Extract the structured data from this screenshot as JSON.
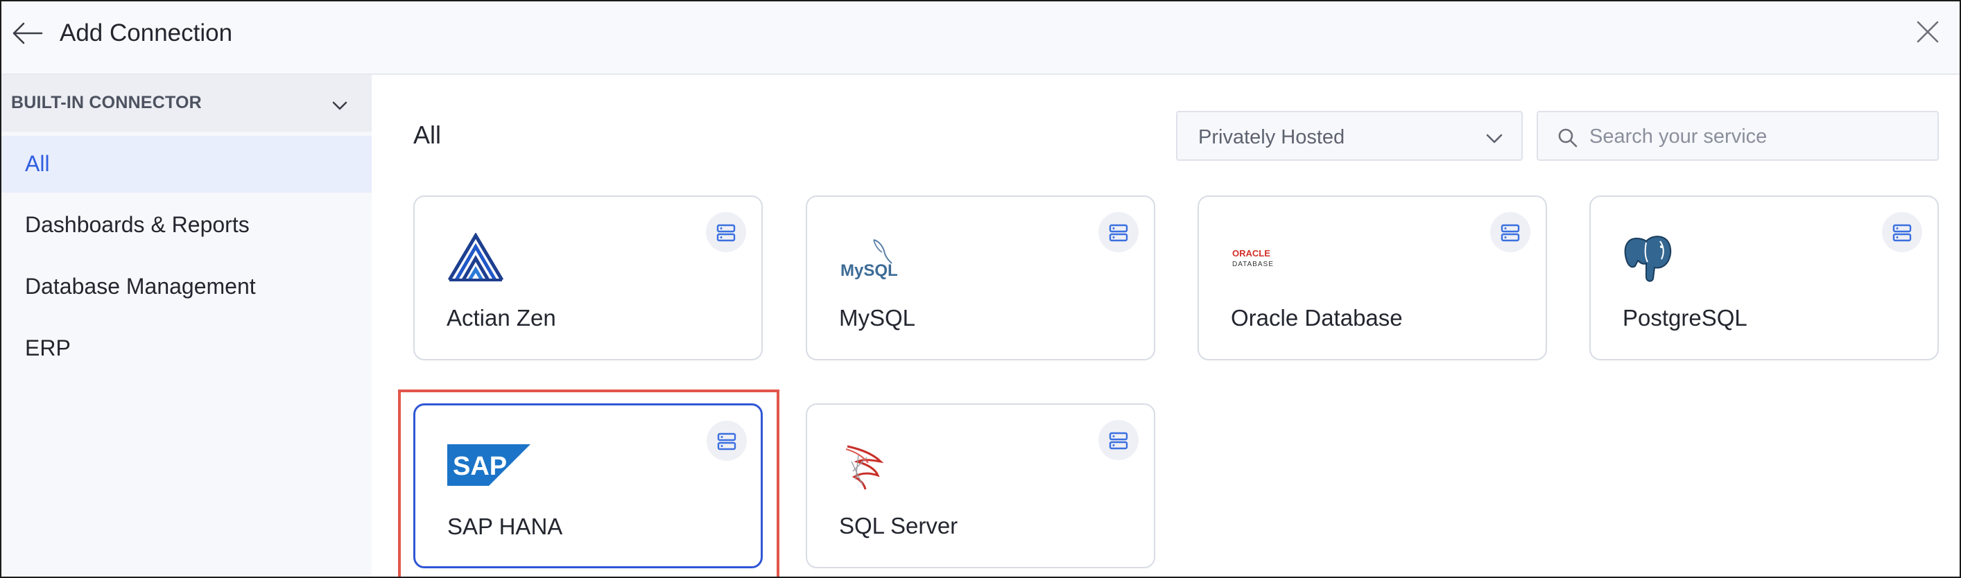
{
  "header": {
    "title": "Add Connection",
    "back_icon": "arrow-left-icon",
    "close_icon": "close-icon"
  },
  "sidebar": {
    "section_label": "BUILT-IN CONNECTOR",
    "items": [
      {
        "label": "All",
        "active": true
      },
      {
        "label": "Dashboards & Reports",
        "active": false
      },
      {
        "label": "Database Management",
        "active": false
      },
      {
        "label": "ERP",
        "active": false
      }
    ]
  },
  "main": {
    "title": "All",
    "filter": {
      "selected": "Privately Hosted"
    },
    "search": {
      "placeholder": "Search your service",
      "value": ""
    },
    "connectors": [
      {
        "name": "Actian Zen",
        "logo": "actian-logo",
        "type_icon": "database-server-icon"
      },
      {
        "name": "MySQL",
        "logo": "mysql-logo",
        "logo_text": "MySQL",
        "type_icon": "database-server-icon"
      },
      {
        "name": "Oracle Database",
        "logo": "oracle-logo",
        "logo_text": "ORACLE",
        "logo_subtext": "DATABASE",
        "type_icon": "database-server-icon"
      },
      {
        "name": "PostgreSQL",
        "logo": "postgresql-elephant-logo",
        "type_icon": "database-server-icon"
      },
      {
        "name": "SAP HANA",
        "logo": "sap-logo",
        "logo_text": "SAP",
        "type_icon": "database-server-icon",
        "selected": true
      },
      {
        "name": "SQL Server",
        "logo": "sql-server-logo",
        "type_icon": "database-server-icon"
      }
    ]
  },
  "colors": {
    "accent": "#2f5ee0",
    "highlight": "#e2564b",
    "sidebar_active_bg": "#e9eefc"
  }
}
